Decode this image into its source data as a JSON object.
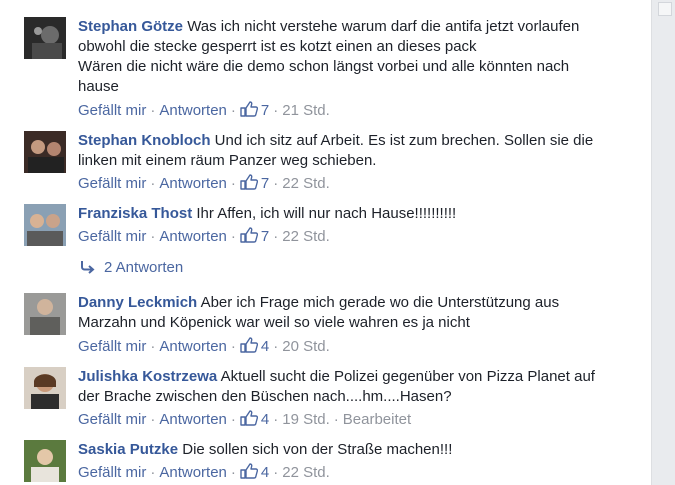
{
  "action_labels": {
    "like": "Gefällt mir",
    "reply": "Antworten",
    "dot": "·"
  },
  "comments": [
    {
      "author": "Stephan Götze",
      "lines": [
        "Was ich nicht verstehe warum darf die antifa jetzt vorlaufen",
        "obwohl die stecke gesperrt ist es kotzt einen an dieses pack",
        "Wären die nicht wäre die demo schon längst vorbei und alle könnten nach",
        "hause"
      ],
      "likes": "7",
      "time": "21 Std.",
      "edited": ""
    },
    {
      "author": "Stephan Knobloch",
      "lines": [
        "Und ich sitz auf Arbeit. Es ist zum brechen. Sollen sie die",
        "linken mit einem räum Panzer weg schieben."
      ],
      "likes": "7",
      "time": "22 Std.",
      "edited": ""
    },
    {
      "author": "Franziska Thost",
      "lines": [
        "Ihr Affen, ich will nur nach Hause!!!!!!!!!!"
      ],
      "likes": "7",
      "time": "22 Std.",
      "edited": ""
    },
    {
      "author": "Danny Leckmich",
      "lines": [
        "Aber ich Frage mich gerade wo die Unterstützung aus",
        "Marzahn und Köpenick war weil so viele wahren es ja nicht"
      ],
      "likes": "4",
      "time": "20 Std.",
      "edited": ""
    },
    {
      "author": "Julishka Kostrzewa",
      "lines": [
        "Aktuell sucht die Polizei gegenüber von Pizza Planet auf",
        "der Brache zwischen den Büschen nach....hm....Hasen?"
      ],
      "likes": "4",
      "time": "19 Std.",
      "edited": "Bearbeitet"
    },
    {
      "author": "Saskia Putzke",
      "lines": [
        "Die sollen sich von der Straße machen!!!"
      ],
      "likes": "4",
      "time": "22 Std.",
      "edited": ""
    }
  ],
  "replies_link": "2 Antworten",
  "icons": {
    "like": "thumbs-up-icon",
    "reply": "reply-arrow-icon"
  },
  "colors": {
    "author": "#365899",
    "link": "#4b67a1",
    "meta": "#90949c",
    "text": "#1d2129"
  }
}
